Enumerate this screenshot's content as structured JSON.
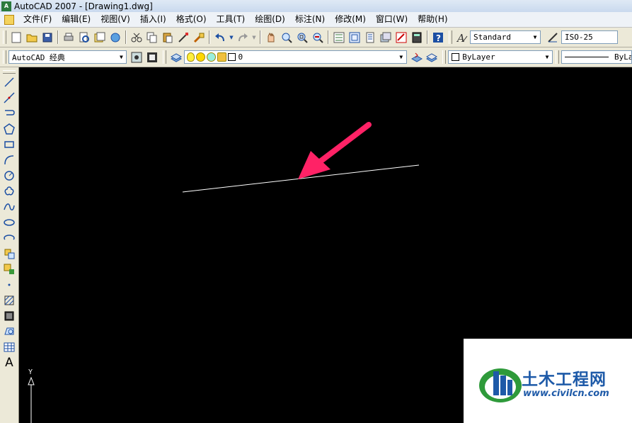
{
  "titlebar": {
    "app_icon": "autocad-app-icon",
    "title": "AutoCAD 2007 - [Drawing1.dwg]"
  },
  "menubar": {
    "items": [
      "文件(F)",
      "编辑(E)",
      "视图(V)",
      "插入(I)",
      "格式(O)",
      "工具(T)",
      "绘图(D)",
      "标注(N)",
      "修改(M)",
      "窗口(W)",
      "帮助(H)"
    ]
  },
  "toolbar_standard": {
    "icons": [
      "new-icon",
      "open-icon",
      "save-icon",
      "print-icon",
      "plot-preview-icon",
      "publish-icon",
      "3d-dwf-icon",
      "cut-icon",
      "copy-icon",
      "paste-icon",
      "match-properties-icon",
      "block-editor-icon",
      "undo-icon",
      "redo-icon",
      "pan-icon",
      "zoom-realtime-icon",
      "zoom-window-icon",
      "zoom-previous-icon",
      "properties-icon",
      "design-center-icon",
      "tool-palettes-icon",
      "sheet-set-icon",
      "markup-icon",
      "quickcalc-icon",
      "help-icon"
    ],
    "text_style_value": "Standard",
    "dim_style_value": "ISO-25"
  },
  "toolbar_workspace": {
    "workspace_value": "AutoCAD 经典",
    "layer_value": "0",
    "color_value": "ByLayer",
    "linetype_value": "ByLay"
  },
  "draw_toolbar": {
    "tools": [
      "line-icon",
      "construction-line-icon",
      "polyline-icon",
      "polygon-icon",
      "rectangle-icon",
      "arc-icon",
      "circle-icon",
      "revision-cloud-icon",
      "spline-icon",
      "ellipse-icon",
      "ellipse-arc-icon",
      "insert-block-icon",
      "make-block-icon",
      "point-icon",
      "hatch-icon",
      "gradient-icon",
      "region-icon",
      "table-icon",
      "multiline-text-icon"
    ],
    "text_tool_label": "A"
  },
  "canvas": {
    "background": "#000000",
    "line_color": "#ffffff",
    "arrow_color": "#ff2266",
    "ucs_label": "Y"
  },
  "watermark": {
    "title": "土木工程网",
    "url": "www.civilcn.com",
    "colors": [
      "#1e5aa8",
      "#2e9a3a"
    ]
  }
}
